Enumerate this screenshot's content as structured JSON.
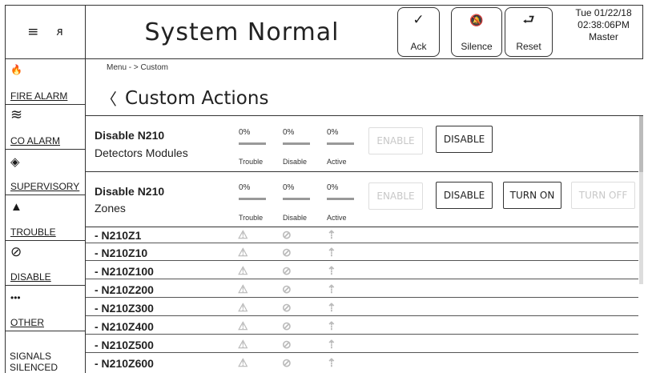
{
  "topbar": {
    "menu_icon": "≡",
    "user_icon": "ᴙ",
    "status": "System Normal",
    "ack": {
      "icon": "✓",
      "label": "Ack"
    },
    "silence": {
      "icon": "🔕",
      "label": "Silence"
    },
    "reset": {
      "icon": "⮐",
      "label": "Reset"
    },
    "datetime": {
      "date": "Tue 01/22/18",
      "time": "02:38:06PM",
      "role": "Master"
    }
  },
  "nav": [
    {
      "icon": "🔥",
      "label": "FIRE ALARM"
    },
    {
      "icon": "≋",
      "label": "CO ALARM"
    },
    {
      "icon": "◈",
      "label": "SUPERVISORY"
    },
    {
      "icon": "▲",
      "label": "TROUBLE"
    },
    {
      "icon": "⊘",
      "label": "DISABLE"
    },
    {
      "icon": "•••",
      "label": "OTHER"
    },
    {
      "icon": "",
      "label": "SIGNALS SILENCED"
    }
  ],
  "breadcrumb": "Menu  - > Custom",
  "page_title": "Custom Actions",
  "back_icon": "〈",
  "groups": [
    {
      "title": "Disable N210",
      "subtitle": "Detectors Modules",
      "stats": [
        {
          "value": "0%",
          "label": "Trouble"
        },
        {
          "value": "0%",
          "label": "Disable"
        },
        {
          "value": "0%",
          "label": "Active"
        }
      ],
      "buttons": [
        {
          "label": "ENABLE",
          "enabled": false
        },
        {
          "label": "DISABLE",
          "enabled": true
        }
      ]
    },
    {
      "title": "Disable N210",
      "subtitle": "Zones",
      "stats": [
        {
          "value": "0%",
          "label": "Trouble"
        },
        {
          "value": "0%",
          "label": "Disable"
        },
        {
          "value": "0%",
          "label": "Active"
        }
      ],
      "buttons": [
        {
          "label": "ENABLE",
          "enabled": false
        },
        {
          "label": "DISABLE",
          "enabled": true
        },
        {
          "label": "TURN ON",
          "enabled": true
        },
        {
          "label": "TURN OFF",
          "enabled": false
        }
      ]
    }
  ],
  "zones": [
    "- N210Z1",
    "- N210Z10",
    "- N210Z100",
    "- N210Z200",
    "- N210Z300",
    "- N210Z400",
    "- N210Z500",
    "- N210Z600"
  ],
  "zone_icons": {
    "trouble": "⚠",
    "disable": "⊘",
    "active": "⇡"
  }
}
